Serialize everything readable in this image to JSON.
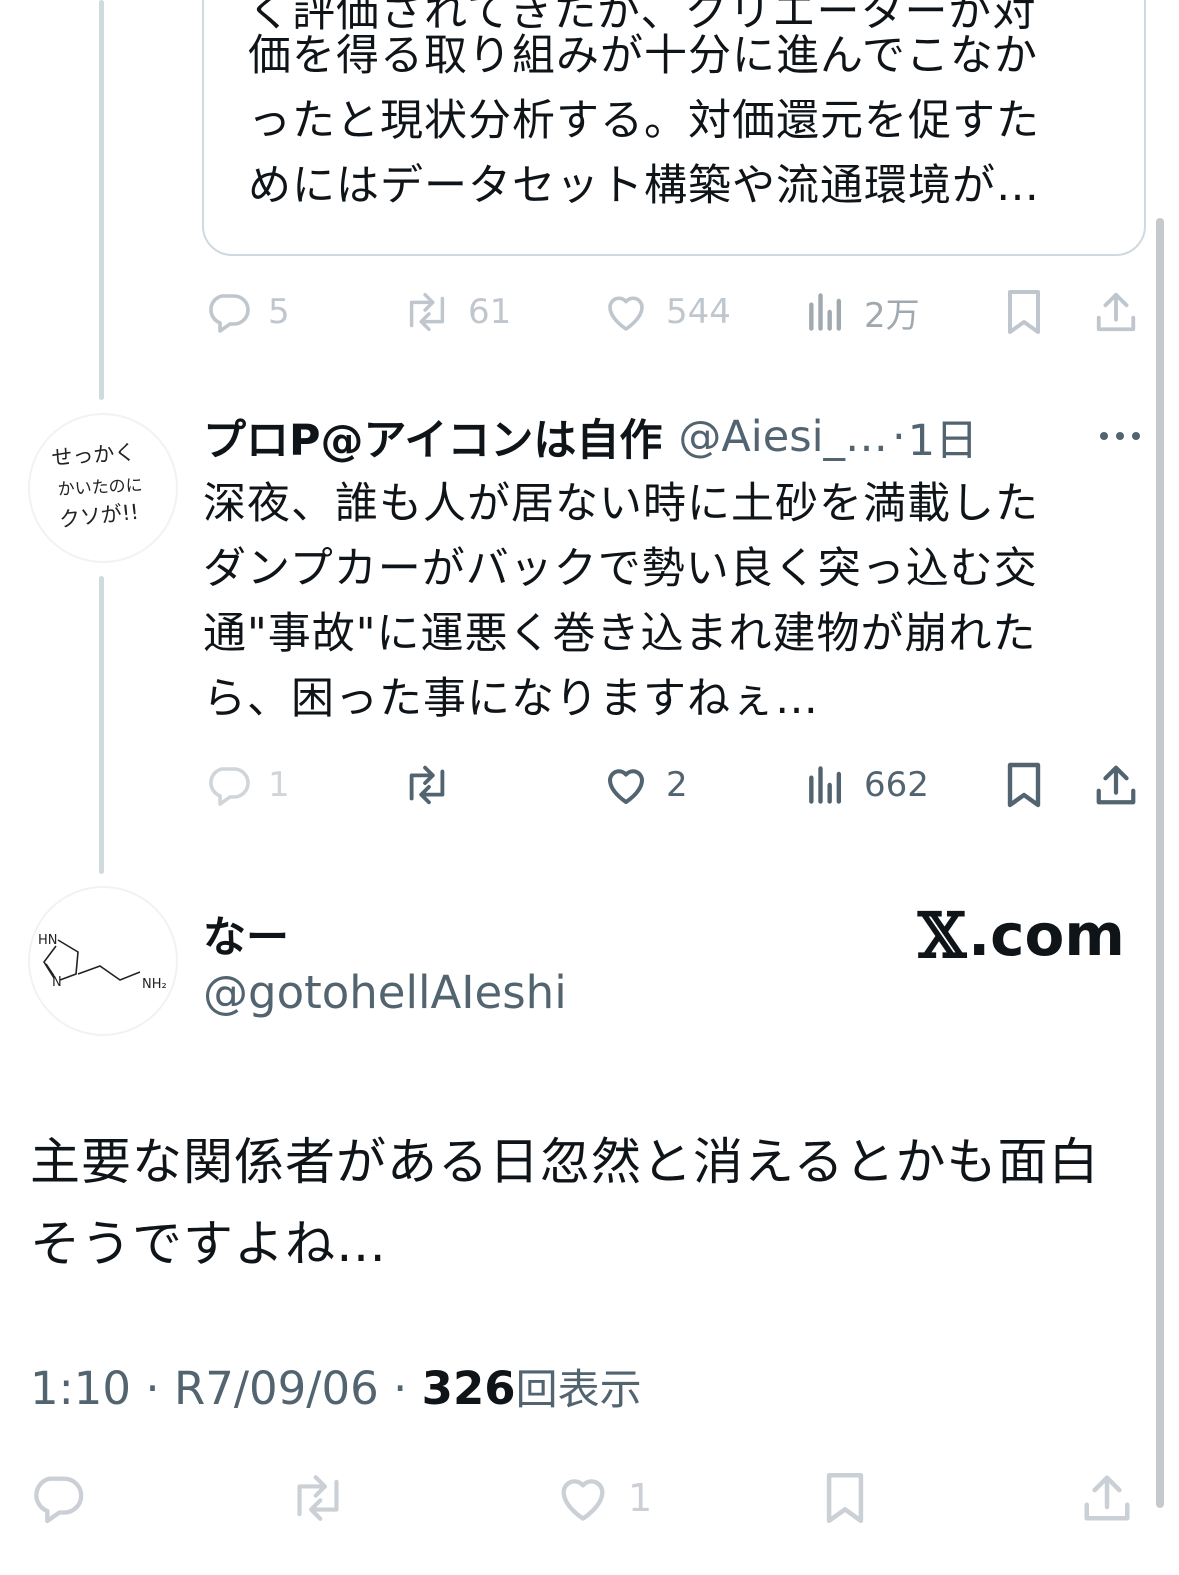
{
  "quoted_tweet": {
    "lines": "価を得る取り組みが十分に進んでこなか\nったと現状分析する。対価還元を促すた\nめにはデータセット構築や流通環境が…",
    "clipped_top_line": "く評価されてきたが、クリエーターが対"
  },
  "tweet1_actions": {
    "reply_count": "5",
    "retweet_count": "61",
    "like_count": "544",
    "views_count": "2万"
  },
  "reply_tweet": {
    "display_name": "プロP@アイコンは自作",
    "handle": "@Aiesi_…",
    "separator": "·",
    "time": "1日",
    "text": "深夜、誰も人が居ない時に土砂を満載した\nダンプカーがバックで勢い良く突っ込む交\n通\"事故\"に運悪く巻き込まれ建物が崩れた\nら、困った事になりますねぇ…",
    "avatar_text": [
      "せっかく",
      "かいたのに",
      "クソが!!"
    ],
    "actions": {
      "reply_count": "1",
      "retweet_count": "",
      "like_count": "2",
      "views_count": "662"
    }
  },
  "main_tweet": {
    "display_name": "なー",
    "handle": "@gotohellAIeshi",
    "brand_mark": "𝕏",
    "brand_suffix": ".com",
    "avatar_labels": {
      "hn": "HN",
      "n": "N",
      "nh2": "NH₂"
    },
    "text": "主要な関係者がある日忽然と消えるとかも面白\nそうですよね…",
    "time": "1:10",
    "separator": " · ",
    "date": "R7/09/06",
    "views_count": "326",
    "views_label": "回表示",
    "actions": {
      "like_count": "1"
    }
  },
  "colors": {
    "text": "#0f1419",
    "secondary": "#536471",
    "icon_muted": "#8b98a5",
    "icon_faded": "#cfd9de",
    "thread_line": "#cfd9de"
  },
  "icons": [
    "reply-icon",
    "retweet-icon",
    "like-icon",
    "views-icon",
    "bookmark-icon",
    "share-icon",
    "more-icon"
  ]
}
